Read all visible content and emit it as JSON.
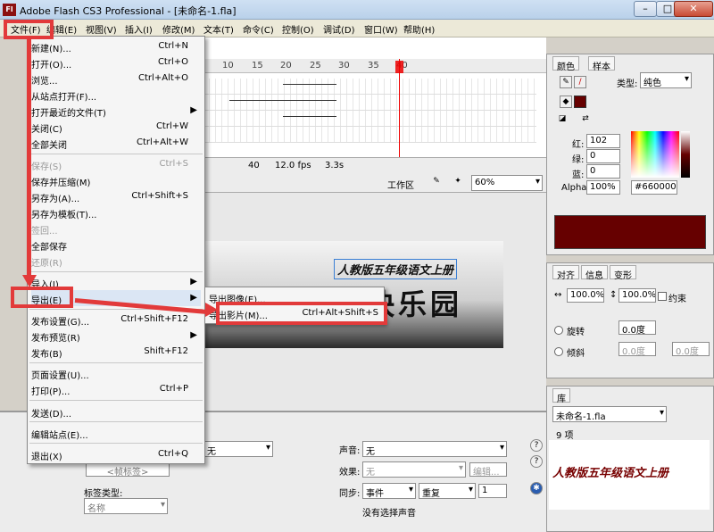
{
  "window": {
    "title": "Adobe Flash CS3 Professional - [未命名-1.fla]",
    "app_icon": "Fl",
    "min": "–",
    "max": "□",
    "close": "✕"
  },
  "menubar": [
    "文件(F)",
    "编辑(E)",
    "视图(V)",
    "插入(I)",
    "修改(M)",
    "文本(T)",
    "命令(C)",
    "控制(O)",
    "调试(D)",
    "窗口(W)",
    "帮助(H)"
  ],
  "file_menu": [
    {
      "label": "新建(N)...",
      "shortcut": "Ctrl+N"
    },
    {
      "label": "打开(O)...",
      "shortcut": "Ctrl+O"
    },
    {
      "label": "浏览...",
      "shortcut": "Ctrl+Alt+O"
    },
    {
      "label": "从站点打开(F)...",
      "shortcut": ""
    },
    {
      "label": "打开最近的文件(T)",
      "shortcut": "▶"
    },
    {
      "label": "关闭(C)",
      "shortcut": "Ctrl+W"
    },
    {
      "label": "全部关闭",
      "shortcut": "Ctrl+Alt+W"
    },
    {
      "label": "保存(S)",
      "shortcut": "Ctrl+S"
    },
    {
      "label": "保存并压缩(M)",
      "shortcut": ""
    },
    {
      "label": "另存为(A)...",
      "shortcut": "Ctrl+Shift+S"
    },
    {
      "label": "另存为模板(T)...",
      "shortcut": ""
    },
    {
      "label": "签回...",
      "shortcut": ""
    },
    {
      "label": "全部保存",
      "shortcut": ""
    },
    {
      "label": "还原(R)",
      "shortcut": ""
    },
    {
      "label": "导入(I)",
      "shortcut": "▶"
    },
    {
      "label": "导出(E)",
      "shortcut": "▶"
    },
    {
      "label": "发布设置(G)...",
      "shortcut": "Ctrl+Shift+F12"
    },
    {
      "label": "发布预览(R)",
      "shortcut": "▶"
    },
    {
      "label": "发布(B)",
      "shortcut": "Shift+F12"
    },
    {
      "label": "页面设置(U)...",
      "shortcut": ""
    },
    {
      "label": "打印(P)...",
      "shortcut": "Ctrl+P"
    },
    {
      "label": "发送(D)...",
      "shortcut": ""
    },
    {
      "label": "编辑站点(E)...",
      "shortcut": ""
    },
    {
      "label": "退出(X)",
      "shortcut": "Ctrl+Q"
    }
  ],
  "export_submenu": [
    {
      "label": "导出图像(E)...",
      "shortcut": ""
    },
    {
      "label": "导出影片(M)...",
      "shortcut": "Ctrl+Alt+Shift+S"
    }
  ],
  "timeline": {
    "ruler": [
      "10",
      "15",
      "20",
      "25",
      "30",
      "35",
      "40"
    ],
    "frame": "40",
    "fps": "12.0 fps",
    "time": "3.3s"
  },
  "stage": {
    "workspace": "工作区",
    "zoom": "60%",
    "banner_text": "人教版五年级语文上册",
    "banner_title": "快乐园"
  },
  "color_panel": {
    "tabs": [
      "颜色",
      "样本"
    ],
    "type_label": "类型:",
    "type_value": "纯色",
    "red_label": "红:",
    "red": "102",
    "green_label": "绿:",
    "green": "0",
    "blue_label": "蓝:",
    "blue": "0",
    "alpha_label": "Alpha:",
    "alpha": "100%",
    "hex": "#660000",
    "swatch": "#660000"
  },
  "transform_panel": {
    "tabs": [
      "对齐",
      "信息",
      "变形"
    ],
    "w": "100.0%",
    "h": "100.0%",
    "constrain": "约束",
    "rotate_label": "旋转",
    "rotate": "0.0度",
    "skew_label": "倾斜",
    "skew1": "0.0度",
    "skew2": "0.0度"
  },
  "library_panel": {
    "tab": "库",
    "doc": "未命名-1.fla",
    "count": "9 项",
    "preview_text": "人教版五年级语文上册"
  },
  "properties": {
    "frame_label_placeholder": "<帧标签>",
    "label_type": "标签类型:",
    "name_value": "名称",
    "tween": "无",
    "sound_label": "声音:",
    "sound_value": "无",
    "effect_label": "效果:",
    "effect_value": "无",
    "edit_button": "编辑...",
    "sync_label": "同步:",
    "sync_value": "事件",
    "repeat_value": "重复",
    "repeat_count": "1",
    "no_sound": "没有选择声音"
  }
}
